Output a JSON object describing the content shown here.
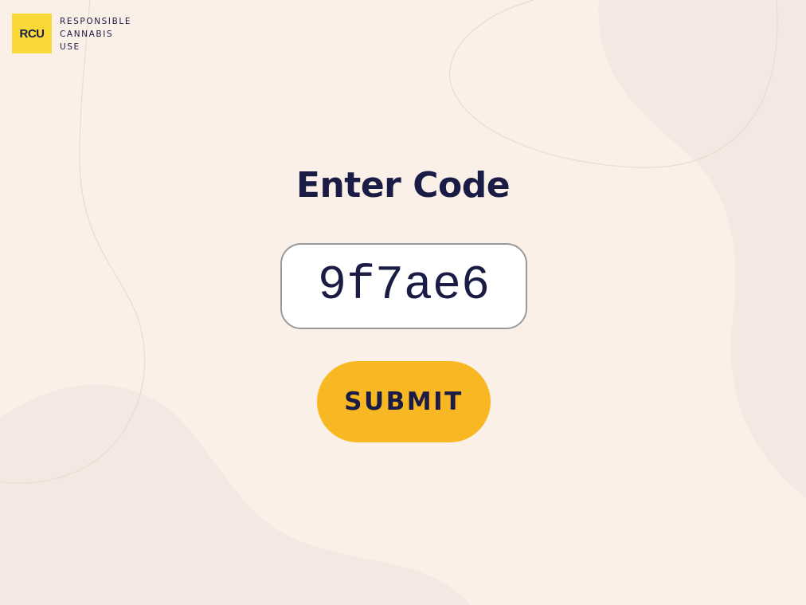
{
  "brand": {
    "logo_mark": "RCU",
    "line1": "RESPONSIBLE",
    "line2": "CANNABIS",
    "line3": "USE"
  },
  "page": {
    "title": "Enter Code"
  },
  "code_input": {
    "value": "9f7ae6"
  },
  "submit": {
    "label": "SUBMIT"
  },
  "colors": {
    "background": "#faf0e8",
    "blob": "#f4e8e2",
    "logo_yellow": "#f9d938",
    "button_yellow": "#f8b823",
    "navy_text": "#1a1c45"
  }
}
